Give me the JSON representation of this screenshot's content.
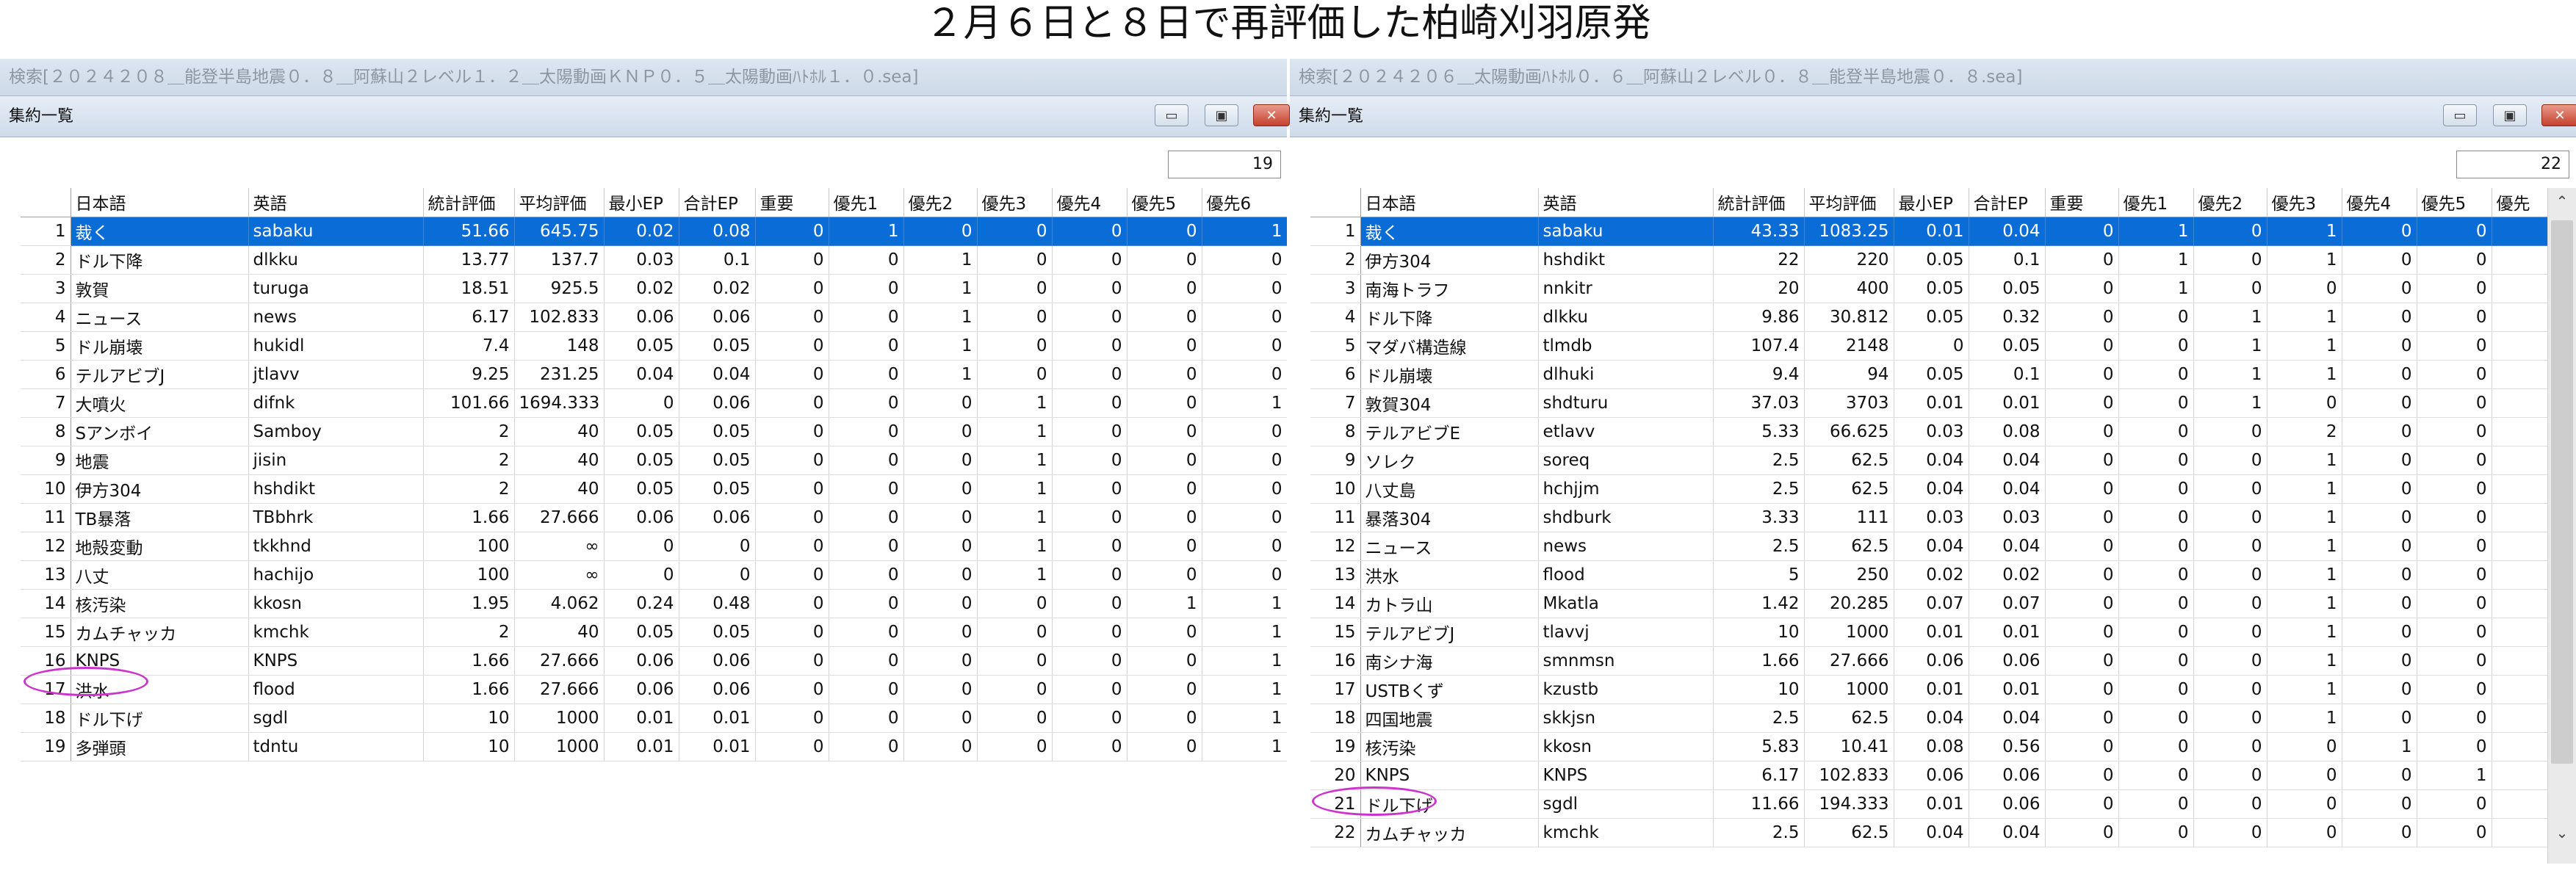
{
  "title": "２月６日と８日で再評価した柏崎刈羽原発",
  "colors": {
    "selection": "#0a6cd6",
    "ring": "#cc33cc"
  },
  "icons": {
    "minimize": "minimize-icon",
    "maximize": "maximize-icon",
    "close": "close-icon",
    "scroll_up": "scroll-up-icon",
    "scroll_down": "scroll-down-icon"
  },
  "window_buttons": {
    "minimize": "▭",
    "maximize": "▣",
    "close": "✕"
  },
  "scroll": {
    "up": "⌃",
    "down": "⌄"
  },
  "left": {
    "search": "検索[２０２４２０８＿能登半島地震０．８＿阿蘇山２レベル１．２＿太陽動画ＫＮＰ０．５＿太陽動画ﾊﾄﾎﾙ１．０.sea]",
    "window_title": "集約一覧",
    "count": "19",
    "headers": [
      "",
      "日本語",
      "英語",
      "統計評価",
      "平均評価",
      "最小EP",
      "合計EP",
      "重要",
      "優先1",
      "優先2",
      "優先3",
      "優先4",
      "優先5",
      "優先6"
    ],
    "rows": [
      [
        "1",
        "裁く",
        "sabaku",
        "51.66",
        "645.75",
        "0.02",
        "0.08",
        "0",
        "1",
        "0",
        "0",
        "0",
        "0",
        "1"
      ],
      [
        "2",
        "ドル下降",
        "dlkku",
        "13.77",
        "137.7",
        "0.03",
        "0.1",
        "0",
        "0",
        "1",
        "0",
        "0",
        "0",
        "0"
      ],
      [
        "3",
        "敦賀",
        "turuga",
        "18.51",
        "925.5",
        "0.02",
        "0.02",
        "0",
        "0",
        "1",
        "0",
        "0",
        "0",
        "0"
      ],
      [
        "4",
        "ニュース",
        "news",
        "6.17",
        "102.833",
        "0.06",
        "0.06",
        "0",
        "0",
        "1",
        "0",
        "0",
        "0",
        "0"
      ],
      [
        "5",
        "ドル崩壊",
        "hukidl",
        "7.4",
        "148",
        "0.05",
        "0.05",
        "0",
        "0",
        "1",
        "0",
        "0",
        "0",
        "0"
      ],
      [
        "6",
        "テルアビブJ",
        "jtlavv",
        "9.25",
        "231.25",
        "0.04",
        "0.04",
        "0",
        "0",
        "1",
        "0",
        "0",
        "0",
        "0"
      ],
      [
        "7",
        "大噴火",
        "difnk",
        "101.66",
        "1694.333",
        "0",
        "0.06",
        "0",
        "0",
        "0",
        "1",
        "0",
        "0",
        "1"
      ],
      [
        "8",
        "Sアンボイ",
        "Samboy",
        "2",
        "40",
        "0.05",
        "0.05",
        "0",
        "0",
        "0",
        "1",
        "0",
        "0",
        "0"
      ],
      [
        "9",
        "地震",
        "jisin",
        "2",
        "40",
        "0.05",
        "0.05",
        "0",
        "0",
        "0",
        "1",
        "0",
        "0",
        "0"
      ],
      [
        "10",
        "伊方304",
        "hshdikt",
        "2",
        "40",
        "0.05",
        "0.05",
        "0",
        "0",
        "0",
        "1",
        "0",
        "0",
        "0"
      ],
      [
        "11",
        "TB暴落",
        "TBbhrk",
        "1.66",
        "27.666",
        "0.06",
        "0.06",
        "0",
        "0",
        "0",
        "1",
        "0",
        "0",
        "0"
      ],
      [
        "12",
        "地殻変動",
        "tkkhnd",
        "100",
        "∞",
        "0",
        "0",
        "0",
        "0",
        "0",
        "1",
        "0",
        "0",
        "0"
      ],
      [
        "13",
        "八丈",
        "hachijo",
        "100",
        "∞",
        "0",
        "0",
        "0",
        "0",
        "0",
        "1",
        "0",
        "0",
        "0"
      ],
      [
        "14",
        "核汚染",
        "kkosn",
        "1.95",
        "4.062",
        "0.24",
        "0.48",
        "0",
        "0",
        "0",
        "0",
        "0",
        "1",
        "1"
      ],
      [
        "15",
        "カムチャッカ",
        "kmchk",
        "2",
        "40",
        "0.05",
        "0.05",
        "0",
        "0",
        "0",
        "0",
        "0",
        "0",
        "1"
      ],
      [
        "16",
        "KNPS",
        "KNPS",
        "1.66",
        "27.666",
        "0.06",
        "0.06",
        "0",
        "0",
        "0",
        "0",
        "0",
        "0",
        "1"
      ],
      [
        "17",
        "洪水",
        "flood",
        "1.66",
        "27.666",
        "0.06",
        "0.06",
        "0",
        "0",
        "0",
        "0",
        "0",
        "0",
        "1"
      ],
      [
        "18",
        "ドル下げ",
        "sgdl",
        "10",
        "1000",
        "0.01",
        "0.01",
        "0",
        "0",
        "0",
        "0",
        "0",
        "0",
        "1"
      ],
      [
        "19",
        "多弾頭",
        "tdntu",
        "10",
        "1000",
        "0.01",
        "0.01",
        "0",
        "0",
        "0",
        "0",
        "0",
        "0",
        "1"
      ]
    ]
  },
  "right": {
    "search": "検索[２０２４２０６＿太陽動画ﾊﾄﾎﾙ０．６＿阿蘇山２レベル０．８＿能登半島地震０．８.sea]",
    "window_title": "集約一覧",
    "count": "22",
    "headers": [
      "",
      "日本語",
      "英語",
      "統計評価",
      "平均評価",
      "最小EP",
      "合計EP",
      "重要",
      "優先1",
      "優先2",
      "優先3",
      "優先4",
      "優先5",
      "優先"
    ],
    "rows": [
      [
        "1",
        "裁く",
        "sabaku",
        "43.33",
        "1083.25",
        "0.01",
        "0.04",
        "0",
        "1",
        "0",
        "1",
        "0",
        "0"
      ],
      [
        "2",
        "伊方304",
        "hshdikt",
        "22",
        "220",
        "0.05",
        "0.1",
        "0",
        "1",
        "0",
        "1",
        "0",
        "0"
      ],
      [
        "3",
        "南海トラフ",
        "nnkitr",
        "20",
        "400",
        "0.05",
        "0.05",
        "0",
        "1",
        "0",
        "0",
        "0",
        "0"
      ],
      [
        "4",
        "ドル下降",
        "dlkku",
        "9.86",
        "30.812",
        "0.05",
        "0.32",
        "0",
        "0",
        "1",
        "1",
        "0",
        "0"
      ],
      [
        "5",
        "マダバ構造線",
        "tlmdb",
        "107.4",
        "2148",
        "0",
        "0.05",
        "0",
        "0",
        "1",
        "1",
        "0",
        "0"
      ],
      [
        "6",
        "ドル崩壊",
        "dlhuki",
        "9.4",
        "94",
        "0.05",
        "0.1",
        "0",
        "0",
        "1",
        "1",
        "0",
        "0"
      ],
      [
        "7",
        "敦賀304",
        "shdturu",
        "37.03",
        "3703",
        "0.01",
        "0.01",
        "0",
        "0",
        "1",
        "0",
        "0",
        "0"
      ],
      [
        "8",
        "テルアビブE",
        "etlavv",
        "5.33",
        "66.625",
        "0.03",
        "0.08",
        "0",
        "0",
        "0",
        "2",
        "0",
        "0"
      ],
      [
        "9",
        "ソレク",
        "soreq",
        "2.5",
        "62.5",
        "0.04",
        "0.04",
        "0",
        "0",
        "0",
        "1",
        "0",
        "0"
      ],
      [
        "10",
        "八丈島",
        "hchjjm",
        "2.5",
        "62.5",
        "0.04",
        "0.04",
        "0",
        "0",
        "0",
        "1",
        "0",
        "0"
      ],
      [
        "11",
        "暴落304",
        "shdburk",
        "3.33",
        "111",
        "0.03",
        "0.03",
        "0",
        "0",
        "0",
        "1",
        "0",
        "0"
      ],
      [
        "12",
        "ニュース",
        "news",
        "2.5",
        "62.5",
        "0.04",
        "0.04",
        "0",
        "0",
        "0",
        "1",
        "0",
        "0"
      ],
      [
        "13",
        "洪水",
        "flood",
        "5",
        "250",
        "0.02",
        "0.02",
        "0",
        "0",
        "0",
        "1",
        "0",
        "0"
      ],
      [
        "14",
        "カトラ山",
        "Mkatla",
        "1.42",
        "20.285",
        "0.07",
        "0.07",
        "0",
        "0",
        "0",
        "1",
        "0",
        "0"
      ],
      [
        "15",
        "テルアビブJ",
        "tlavvj",
        "10",
        "1000",
        "0.01",
        "0.01",
        "0",
        "0",
        "0",
        "1",
        "0",
        "0"
      ],
      [
        "16",
        "南シナ海",
        "smnmsn",
        "1.66",
        "27.666",
        "0.06",
        "0.06",
        "0",
        "0",
        "0",
        "1",
        "0",
        "0"
      ],
      [
        "17",
        "USTBくず",
        "kzustb",
        "10",
        "1000",
        "0.01",
        "0.01",
        "0",
        "0",
        "0",
        "1",
        "0",
        "0"
      ],
      [
        "18",
        "四国地震",
        "skkjsn",
        "2.5",
        "62.5",
        "0.04",
        "0.04",
        "0",
        "0",
        "0",
        "1",
        "0",
        "0"
      ],
      [
        "19",
        "核汚染",
        "kkosn",
        "5.83",
        "10.41",
        "0.08",
        "0.56",
        "0",
        "0",
        "0",
        "0",
        "1",
        "0"
      ],
      [
        "20",
        "KNPS",
        "KNPS",
        "6.17",
        "102.833",
        "0.06",
        "0.06",
        "0",
        "0",
        "0",
        "0",
        "0",
        "1"
      ],
      [
        "21",
        "ドル下げ",
        "sgdl",
        "11.66",
        "194.333",
        "0.01",
        "0.06",
        "0",
        "0",
        "0",
        "0",
        "0",
        "0"
      ],
      [
        "22",
        "カムチャッカ",
        "kmchk",
        "2.5",
        "62.5",
        "0.04",
        "0.04",
        "0",
        "0",
        "0",
        "0",
        "0",
        "0"
      ]
    ]
  }
}
